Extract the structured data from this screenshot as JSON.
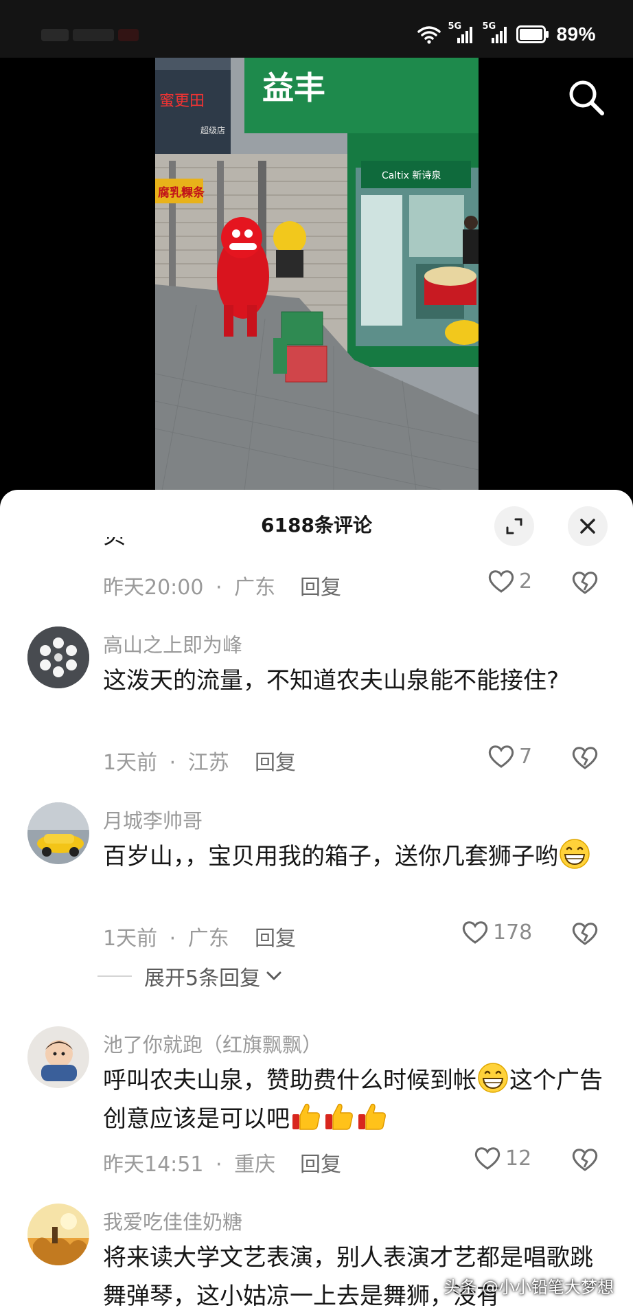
{
  "status_bar": {
    "network_1": "5G",
    "network_2": "5G",
    "battery": "89%",
    "icons": [
      "wifi-icon",
      "signal-icon",
      "signal-icon",
      "battery-icon"
    ]
  },
  "video": {
    "store_sign": "益丰",
    "shop_sign_left": "腐乳粿条",
    "search_icon": "search-icon"
  },
  "comments_panel": {
    "title": "6188条评论",
    "expand_icon": "expand-icon",
    "close_icon": "close-icon"
  },
  "comments": [
    {
      "username": "",
      "content": "贝",
      "time": "昨天20:00",
      "location": "广东",
      "reply": "回复",
      "likes": "2"
    },
    {
      "username": "高山之上即为峰",
      "content": "这泼天的流量，不知道农夫山泉能不能接住?",
      "time": "1天前",
      "location": "江苏",
      "reply": "回复",
      "likes": "7"
    },
    {
      "username": "月城李帅哥",
      "content_a": "百岁山，，宝贝用我的箱子，送你几套狮子哟",
      "time": "1天前",
      "location": "广东",
      "reply": "回复",
      "likes": "178",
      "expand_replies": "展开5条回复"
    },
    {
      "username": "池了你就跑（红旗飘飘）",
      "content_a": "呼叫农夫山泉，赞助费什么时候到帐",
      "content_b": "这个广告创意应该是可以吧",
      "time": "昨天14:51",
      "location": "重庆",
      "reply": "回复",
      "likes": "12"
    },
    {
      "username": "我爱吃佳佳奶糖",
      "content": "将来读大学文艺表演，别人表演才艺都是唱歌跳舞弹琴，这小姑凉一上去是舞狮，没有"
    }
  ],
  "meta_separator": "·",
  "watermark": "头条 @小小铅笔大梦想",
  "colors": {
    "status_bar_bg": "#141414",
    "sheet_bg": "#ffffff",
    "text_primary": "#161616",
    "text_secondary": "#9a9a9a",
    "store_green": "#1e8a4c",
    "lion_red": "#e0141e",
    "lion_yellow": "#f2c81c"
  }
}
